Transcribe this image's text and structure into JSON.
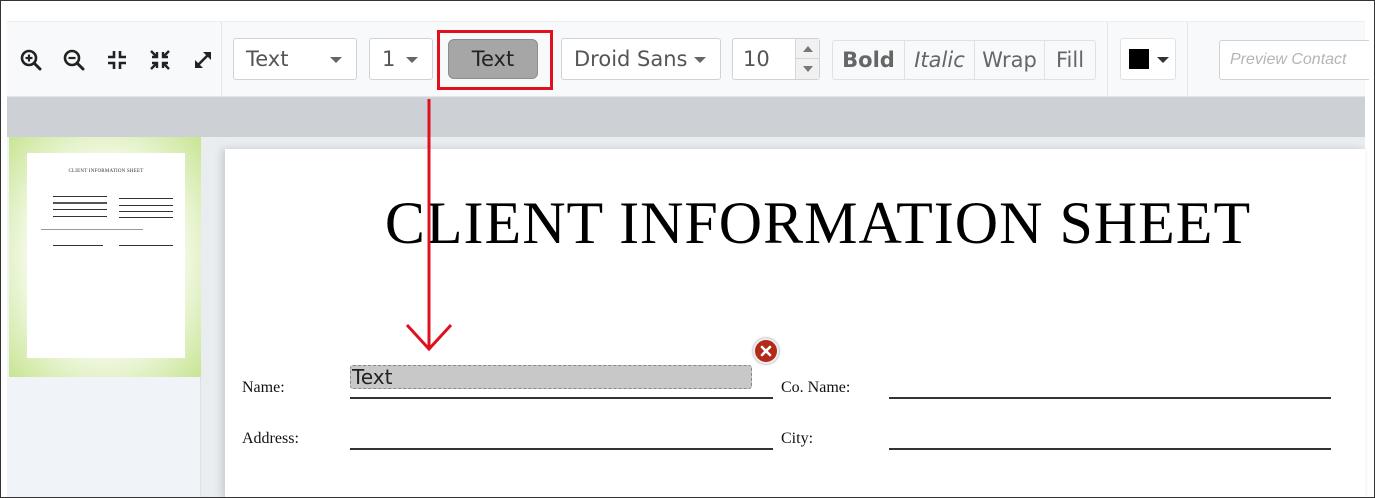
{
  "toolbar": {
    "zoom_icons": [
      "zoom-in-icon",
      "zoom-out-icon",
      "fit-width-icon",
      "fit-page-icon",
      "fullscreen-icon"
    ],
    "field_type_select": {
      "value": "Text"
    },
    "page_select": {
      "value": "1"
    },
    "add_field_button": {
      "label": "Text"
    },
    "font_select": {
      "value": "Droid Sans"
    },
    "font_size": {
      "value": "10"
    },
    "format_buttons": {
      "bold": "Bold",
      "italic": "Italic",
      "wrap": "Wrap",
      "fill": "Fill"
    },
    "color_picker": {
      "color": "#000000"
    },
    "preview_input": {
      "placeholder": "Preview Contact"
    }
  },
  "document": {
    "title": "CLIENT INFORMATION SHEET",
    "labels": {
      "name": "Name:",
      "co_name": "Co. Name:",
      "address": "Address:",
      "city": "City:"
    },
    "text_field": {
      "value": "Text"
    }
  },
  "annotation": {
    "highlight_color": "#e0101e"
  }
}
